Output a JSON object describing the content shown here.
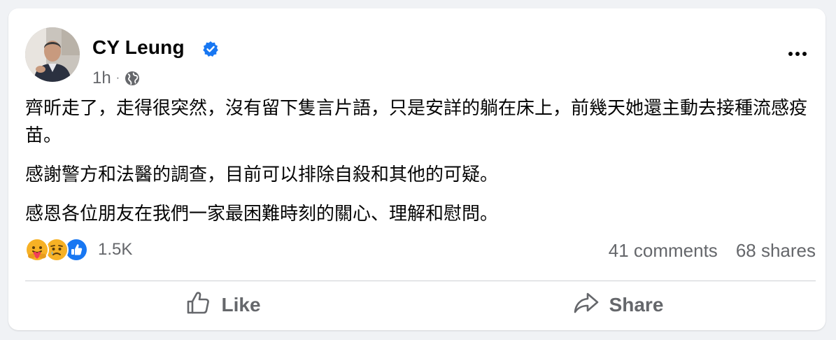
{
  "post": {
    "author": "CY Leung",
    "verified_icon": "verified-badge-icon",
    "time": "1h",
    "separator": "·",
    "audience_icon": "globe-icon",
    "paragraphs": [
      "齊昕走了，走得很突然，沒有留下隻言片語，只是安詳的躺在床上，前幾天她還主動去接種流感疫苗。",
      "感謝警方和法醫的調查，目前可以排除自殺和其他的可疑。",
      "感恩各位朋友在我們一家最困難時刻的關心、理解和慰問。"
    ],
    "reactions": {
      "icons": [
        "care-reaction-icon",
        "sad-reaction-icon",
        "like-reaction-icon"
      ],
      "count": "1.5K"
    },
    "comments": "41 comments",
    "shares": "68 shares"
  },
  "actions": {
    "like_label": "Like",
    "share_label": "Share"
  },
  "colors": {
    "text": "#050505",
    "secondary_text": "#65676b",
    "verified_blue": "#1877f2",
    "background": "#f0f2f5",
    "card": "#ffffff"
  }
}
